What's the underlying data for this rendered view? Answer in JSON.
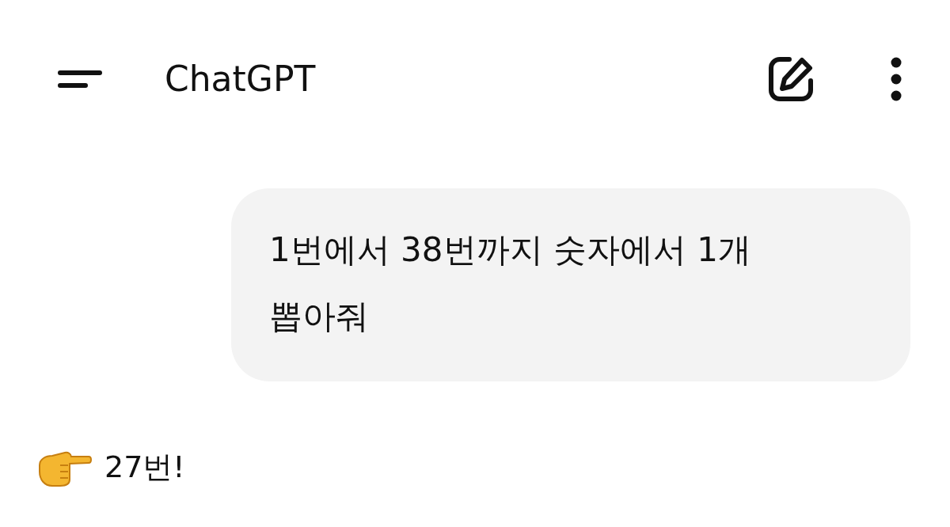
{
  "header": {
    "title": "ChatGPT"
  },
  "messages": [
    {
      "kind": "user",
      "text": "1번에서 38번까지 숫자에서 1개 뽑아줘"
    },
    {
      "kind": "assistant",
      "text": "27번!"
    }
  ]
}
